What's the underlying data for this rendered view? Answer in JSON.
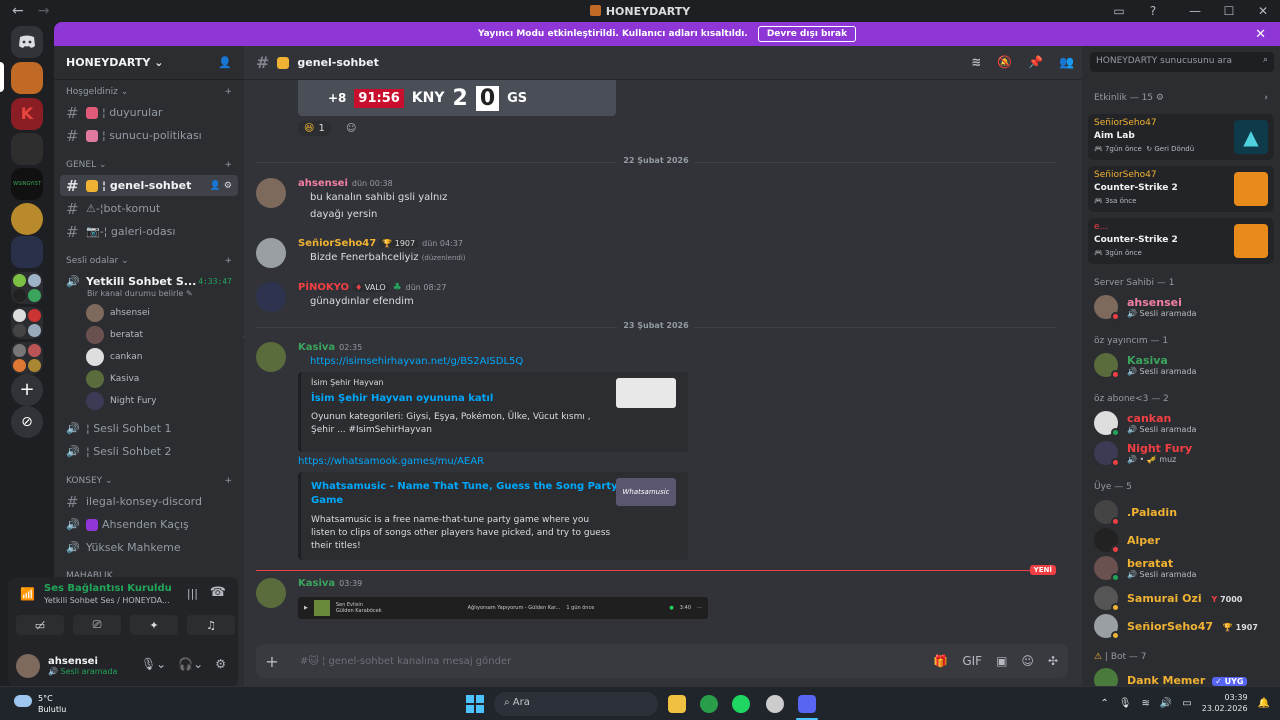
{
  "app": {
    "title": "HONEYDARTY",
    "back": "←",
    "forward": "→"
  },
  "banner": {
    "text": "Yayıncı Modu etkinleştirildi. Kullanıcı adları kısaltıldı.",
    "button": "Devre dışı bırak"
  },
  "server": {
    "name": "HONEYDARTY"
  },
  "categories": {
    "welcome": "Hoşgeldiniz",
    "general": "GENEL",
    "voice": "Sesli odalar",
    "council": "KONSEY",
    "cut": "MAHABLIK"
  },
  "channels": {
    "duyurular": "¦ duyurular",
    "politika": "¦ sunucu-politikası",
    "genel": "¦ genel-sohbet",
    "bot": "⚠-¦bot-komut",
    "galeri": "📷-¦ galeri-odası",
    "yetkili": "Yetkili Sohbet S...",
    "yetkili_time": "4:33:47",
    "yetkili_status": "Bir kanal durumu belirle",
    "sesli1": "¦ Sesli Sohbet 1",
    "sesli2": "¦ Sesli Sohbet 2",
    "ilegal": "ilegal-konsey-discord",
    "ahsenden": "Ahsenden Kaçış",
    "yuksek": "Yüksek Mahkeme"
  },
  "voice_users": [
    "ahsensei",
    "beratat",
    "cankan",
    "Kasiva",
    "Night Fury"
  ],
  "voice": {
    "status": "Ses Bağlantısı Kuruldu",
    "channel": "Yetkili Sohbet Ses / HONEYDA..."
  },
  "me": {
    "name": "ahsensei",
    "status": "Sesli aramada"
  },
  "chat": {
    "channel": "genel-sohbet",
    "placeholder": "#🐱 ¦ genel-sohbet kanalına mesaj gönder"
  },
  "score": {
    "left": "+8",
    "time": "91:56",
    "team1": "KNY",
    "s1": "2",
    "s2": "0",
    "team2": "GS"
  },
  "reactions": {
    "count": "1"
  },
  "dates": {
    "d1": "22 Şubat 2026",
    "d2": "23 Şubat 2026",
    "new": "YENİ"
  },
  "messages": [
    {
      "name": "ahsensei",
      "time": "dün 00:38",
      "lines": [
        "bu kanalın sahibi gsli yalnız",
        "dayağı yersin"
      ],
      "color": "#f47fa4"
    },
    {
      "name": "SeñiorSeho47",
      "tag": "🏆 1907",
      "time": "dün 04:37",
      "lines": [
        "Bizde Fenerbahceliyiz"
      ],
      "edited": "(düzenlendi)",
      "color": "#f0b232"
    },
    {
      "name": "PİNOKYO",
      "tag": "VALO",
      "time": "dün 08:27",
      "lines": [
        "günaydınlar efendim"
      ],
      "color": "#f23f43"
    },
    {
      "name": "Kasiva",
      "time": "02:35",
      "link1": "https://isimsehirhayvan.net/g/BS2AISDL5Q",
      "link2": "https://whatsamook.games/mu/AEAR",
      "color": "#3ba55d"
    },
    {
      "name": "Kasiva",
      "time": "03:39",
      "color": "#3ba55d"
    }
  ],
  "embeds": [
    {
      "provider": "İsim Şehir Hayvan",
      "title": "İsim Şehir Hayvan oyununa katıl",
      "desc": [
        "Oyunun kategorileri: Giysi, Eşya, Pokémon, Ülke, Vücut kısmı ,",
        "Şehir ... #IsimSehirHayvan"
      ]
    },
    {
      "title": [
        "Whatsamusic - Name That Tune, Guess the Song Party",
        "Game"
      ],
      "desc": [
        "Whatsamusic is a free name-that-tune party game where you",
        "listen to clips of songs other players have picked, and try to guess",
        "their titles!"
      ],
      "thumb": "Whatsamusic"
    }
  ],
  "spotify": {
    "song": "Sen Evlisin",
    "artist": "Gülden Karaböcek",
    "next": "Ağlıyorsam Yapıyorum - Gülden Kar...",
    "ago": "1 gün önce",
    "dur": "3:40"
  },
  "search": {
    "placeholder": "HONEYDARTY sunucusunu ara"
  },
  "activity": {
    "header": "Etkinlik — 15",
    "items": [
      {
        "who": "SeñiorSeho47",
        "game": "Aim Lab",
        "time": "7gün önce",
        "extra": "Geri Döndü"
      },
      {
        "who": "SeñiorSeho47",
        "game": "Counter-Strike 2",
        "time": "3sa önce"
      },
      {
        "who": "e...",
        "game": "Counter-Strike 2",
        "time": "3gün önce"
      }
    ]
  },
  "member_groups": [
    {
      "header": "Server Sahibi — 1",
      "members": [
        {
          "name": "ahsensei",
          "status": "Sesli aramada",
          "color": "#f47fa4"
        }
      ]
    },
    {
      "header": "öz yayıncım — 1",
      "members": [
        {
          "name": "Kasiva",
          "status": "Sesli aramada",
          "color": "#3ba55d"
        }
      ]
    },
    {
      "header": "öz abone<3 — 2",
      "members": [
        {
          "name": "cankan",
          "status": "Sesli aramada",
          "color": "#f23f43"
        },
        {
          "name": "Night Fury",
          "status": "• 🎺 muz",
          "color": "#f23f43"
        }
      ]
    },
    {
      "header": "Üye — 5",
      "members": [
        {
          "name": ".Paladin",
          "color": "#f0b232"
        },
        {
          "name": "Alper",
          "color": "#f0b232"
        },
        {
          "name": "beratat",
          "status": "Sesli aramada",
          "color": "#f0b232"
        },
        {
          "name": "Samurai Ozi",
          "tag": "7000",
          "color": "#f0b232"
        },
        {
          "name": "SeñiorSeho47",
          "tag": "1907",
          "color": "#f0b232"
        }
      ]
    },
    {
      "header": "| Bot — 7",
      "members": [
        {
          "name": "Dank Memer",
          "tag": "UYG",
          "color": "#f0b232"
        }
      ]
    }
  ],
  "taskbar": {
    "temp": "5°C",
    "weather": "Bulutlu",
    "search": "Ara",
    "time": "03:39",
    "date": "23.02.2026"
  }
}
